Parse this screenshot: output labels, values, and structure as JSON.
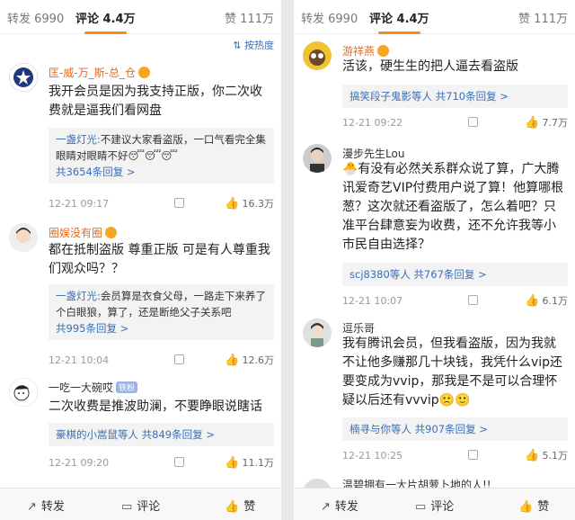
{
  "left": {
    "tabs": {
      "forward": "转发 6990",
      "comment": "评论 4.4万",
      "like": "赞 111万"
    },
    "sort": "按热度",
    "comments": [
      {
        "name": "匡-威-万_斯-总_仓",
        "text": "我开会员是因为我支持正版，你二次收费就是逼我们看网盘",
        "reply_user": "一盏灯光:",
        "reply_text": "不建议大家看盗版，一口气看完全集眼睛对眼睛不好😴😴😴",
        "reply_more": "共3654条回复 >",
        "time": "12-21 09:17",
        "likes": "16.3万"
      },
      {
        "name": "圈娱没有圈",
        "text": "都在抵制盗版 尊重正版 可是有人尊重我们观众吗？？",
        "reply_user": "一盏灯光:",
        "reply_text": "会员算是衣食父母，一路走下来养了个白眼狼，算了，还是断绝父子关系吧",
        "reply_more": "共995条回复 >",
        "time": "12-21 10:04",
        "likes": "12.6万"
      },
      {
        "name": "一吃一大碗哎",
        "badge": "铁粉",
        "text": "二次收费是推波助澜，不要睁眼说瞎话",
        "reply_user": "豪棋的小嵩鼠等人",
        "reply_more": "共849条回复 >",
        "time": "12-21 09:20",
        "likes": "11.1万"
      }
    ],
    "bottom": {
      "forward": "转发",
      "comment": "评论",
      "like": "赞"
    }
  },
  "right": {
    "tabs": {
      "forward": "转发 6990",
      "comment": "评论 4.4万",
      "like": "赞 111万"
    },
    "comments": [
      {
        "name": "游祥燕",
        "text": "活该，硬生生的把人逼去看盗版",
        "reply_user": "搞笑段子鬼影等人",
        "reply_more": "共710条回复 >",
        "time": "12-21 09:22",
        "likes": "7.7万"
      },
      {
        "name": "漫步先生Lou",
        "text": "🐣有没有必然关系群众说了算，广大腾讯爱奇艺VIP付费用户说了算！他算哪根葱？这次就还看盗版了，怎么着吧？只准平台肆意妄为收费，还不允许我等小市民自由选择？",
        "reply_user": "scj8380等人",
        "reply_more": "共767条回复 >",
        "time": "12-21 10:07",
        "likes": "6.1万"
      },
      {
        "name": "逗乐哥",
        "text": "我有腾讯会员，但我看盗版，因为我就不让他多赚那几十块钱，我凭什么vip还要变成为vvip，那我是不是可以合理怀疑以后还有vvvip🙁🙂",
        "reply_user": "楠寻与你等人",
        "reply_more": "共907条回复 >",
        "time": "12-21 10:25",
        "likes": "5.1万"
      }
    ],
    "peek_name": "温碧拥有一大片胡萝卜地的人!!",
    "bottom": {
      "forward": "转发",
      "comment": "评论",
      "like": "赞"
    }
  },
  "colors": {
    "accent": "#f68b16",
    "link": "#3b6fb6",
    "name": "#e86a1d"
  }
}
